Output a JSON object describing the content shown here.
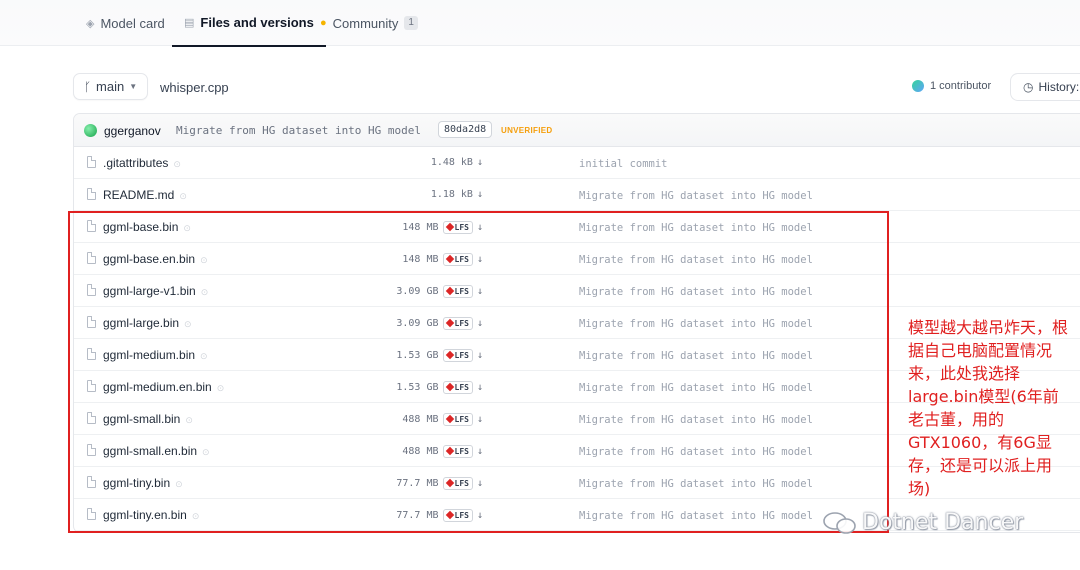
{
  "tabs": [
    {
      "label": "Model card",
      "icon": "cube-icon",
      "active": false
    },
    {
      "label": "Files and versions",
      "icon": "files-icon",
      "active": true
    },
    {
      "label": "Community",
      "icon": "community-icon",
      "active": false,
      "badge": "1"
    }
  ],
  "branch": {
    "label": "main"
  },
  "repo": {
    "path": "whisper.cpp"
  },
  "contributors": {
    "label": "1 contributor"
  },
  "history": {
    "label": "History:"
  },
  "commit": {
    "author": "ggerganov",
    "message": "Migrate from HG dataset into HG model",
    "hash": "80da2d8",
    "status": "UNVERIFIED"
  },
  "files": [
    {
      "name": ".gitattributes",
      "size": "1.48 kB",
      "lfs": false,
      "commit": "initial commit"
    },
    {
      "name": "README.md",
      "size": "1.18 kB",
      "lfs": false,
      "commit": "Migrate from HG dataset into HG model"
    },
    {
      "name": "ggml-base.bin",
      "size": "148 MB",
      "lfs": true,
      "commit": "Migrate from HG dataset into HG model"
    },
    {
      "name": "ggml-base.en.bin",
      "size": "148 MB",
      "lfs": true,
      "commit": "Migrate from HG dataset into HG model"
    },
    {
      "name": "ggml-large-v1.bin",
      "size": "3.09 GB",
      "lfs": true,
      "commit": "Migrate from HG dataset into HG model"
    },
    {
      "name": "ggml-large.bin",
      "size": "3.09 GB",
      "lfs": true,
      "commit": "Migrate from HG dataset into HG model"
    },
    {
      "name": "ggml-medium.bin",
      "size": "1.53 GB",
      "lfs": true,
      "commit": "Migrate from HG dataset into HG model"
    },
    {
      "name": "ggml-medium.en.bin",
      "size": "1.53 GB",
      "lfs": true,
      "commit": "Migrate from HG dataset into HG model"
    },
    {
      "name": "ggml-small.bin",
      "size": "488 MB",
      "lfs": true,
      "commit": "Migrate from HG dataset into HG model"
    },
    {
      "name": "ggml-small.en.bin",
      "size": "488 MB",
      "lfs": true,
      "commit": "Migrate from HG dataset into HG model"
    },
    {
      "name": "ggml-tiny.bin",
      "size": "77.7 MB",
      "lfs": true,
      "commit": "Migrate from HG dataset into HG model"
    },
    {
      "name": "ggml-tiny.en.bin",
      "size": "77.7 MB",
      "lfs": true,
      "commit": "Migrate from HG dataset into HG model"
    }
  ],
  "lfs_label": "LFS",
  "annotation": {
    "text": "模型越大越吊炸天，根据自己电脑配置情况来，此处我选择large.bin模型(6年前老古董，用的GTX1060，有6G显存，还是可以派上用场)",
    "color": "#e02020"
  },
  "watermark": {
    "text": "Dotnet Dancer"
  },
  "colors": {
    "accent_red": "#e02020",
    "lfs_gem": "#dc2626",
    "unverified": "#f59e0b"
  }
}
